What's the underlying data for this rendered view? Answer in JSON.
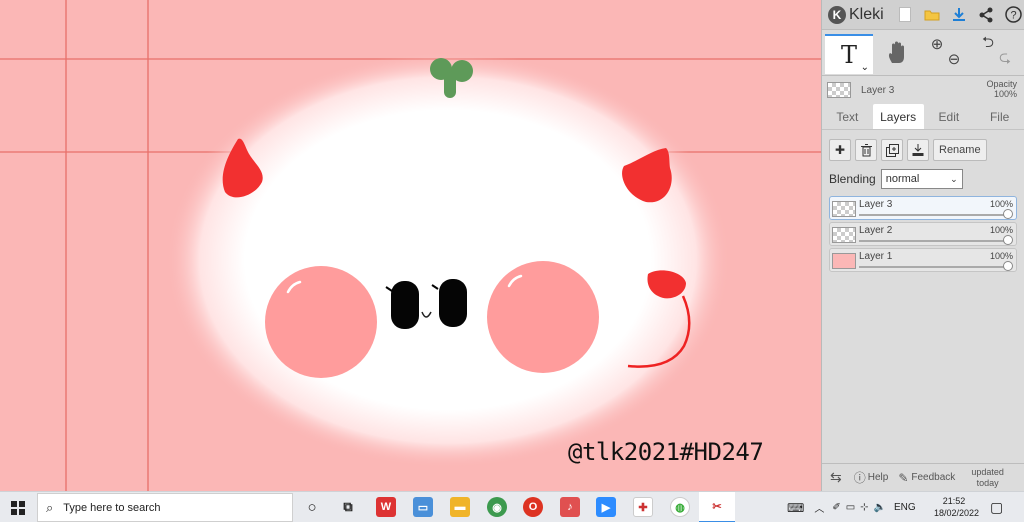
{
  "app": {
    "logo_text": "Kleki",
    "top_icons": [
      "new-file-icon",
      "open-folder-icon",
      "download-icon",
      "share-icon",
      "help-icon"
    ]
  },
  "tools": {
    "active_tool_glyph": "T",
    "active_tool_name": "text-tool",
    "others": [
      "hand-tool",
      "zoom-in-icon",
      "zoom-out-icon",
      "undo-icon",
      "redo-icon"
    ]
  },
  "current_layer": {
    "name": "Layer 3",
    "opacity_label": "Opacity",
    "opacity_value": "100%"
  },
  "tabs": [
    {
      "label": "Text",
      "active": false
    },
    {
      "label": "Layers",
      "active": true
    },
    {
      "label": "Edit",
      "active": false
    },
    {
      "label": "File",
      "active": false
    }
  ],
  "layer_buttons": {
    "rename": "Rename"
  },
  "blending": {
    "label": "Blending",
    "value": "normal"
  },
  "layers": [
    {
      "name": "Layer 3",
      "opacity": "100%",
      "opacity_level": 1.0,
      "active": true
    },
    {
      "name": "Layer 2",
      "opacity": "100%",
      "opacity_level": 1.0,
      "active": false
    },
    {
      "name": "Layer 1",
      "opacity": "100%",
      "opacity_level": 1.0,
      "active": false
    }
  ],
  "bottom_bar": {
    "help": "Help",
    "feedback": "Feedback",
    "updated_line1": "updated",
    "updated_line2": "today"
  },
  "canvas": {
    "watermark": "@tlk2021#HD247",
    "background_color": "#fbb7b6"
  },
  "taskbar": {
    "search_placeholder": "Type here to search",
    "language": "ENG",
    "time": "21:52",
    "date": "18/02/2022"
  }
}
